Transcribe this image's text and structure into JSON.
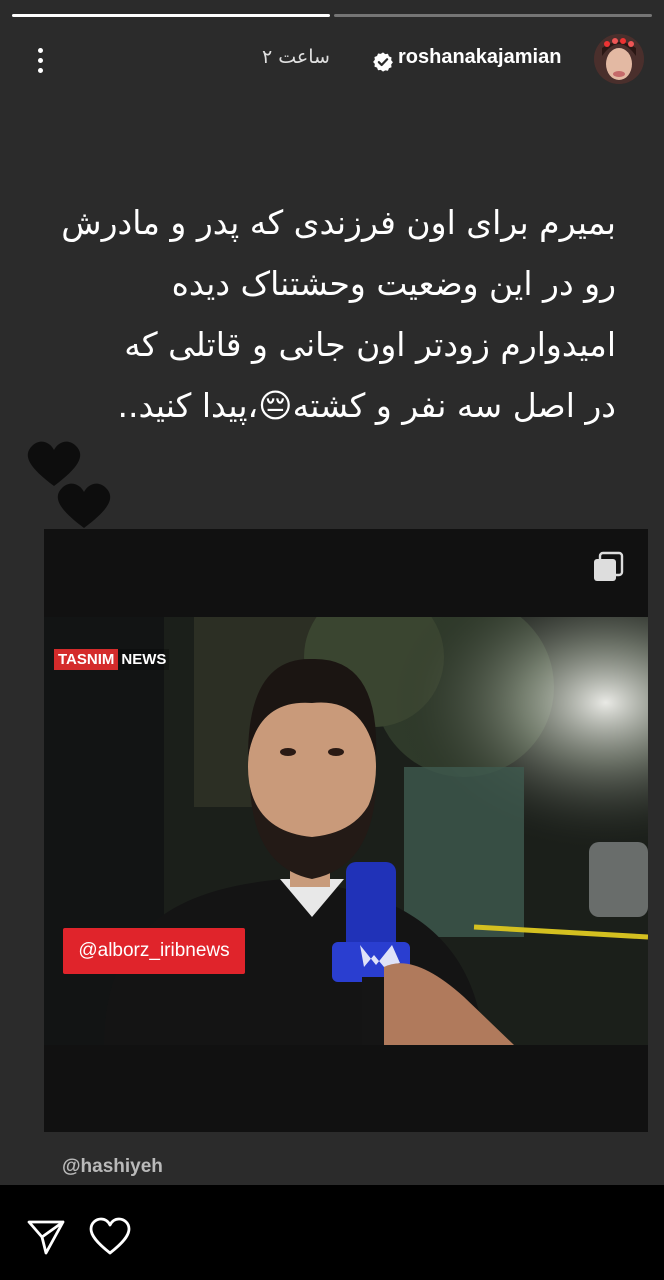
{
  "story": {
    "progress_segments": [
      {
        "filled_fraction": 1.0
      },
      {
        "filled_fraction": 0.0
      }
    ],
    "header": {
      "username": "roshanakajamian",
      "time_ago": "۲ ساعت",
      "verified": true,
      "menu_icon": "more-vertical-icon",
      "verified_icon": "verified-badge-icon"
    },
    "caption_lines": [
      "بمیرم برای اون فرزندی که پدر و مادرش",
      "رو در این وضعیت وحشتناک دیده",
      "امیدوارم زودتر اون جانی و قاتلی که",
      "در اصل سه نفر و کشته😔،پیدا کنید.."
    ],
    "sticker": "black-hearts-icon",
    "video": {
      "carousel_icon": "multiple-posts-icon",
      "news_logo": {
        "part1": "TASNIM",
        "part2": "NEWS"
      },
      "overlay_handle": "@alborz_iribnews"
    },
    "watermark": "@hashiyeh"
  },
  "actions": {
    "send_icon": "send-icon",
    "like_icon": "heart-outline-icon"
  },
  "colors": {
    "story_background": "#2b2b2b",
    "news_red": "#e0242b",
    "tasnim_red": "#d42b2b"
  }
}
